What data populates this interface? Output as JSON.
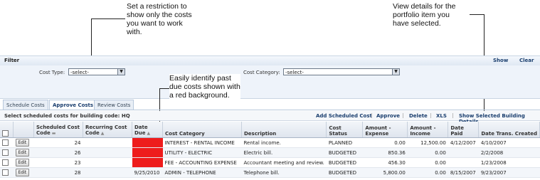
{
  "callouts": {
    "restriction": [
      "Set a restriction to",
      "show only the costs",
      "you want to work",
      "with."
    ],
    "details": [
      "View details for the",
      "portfolio item you",
      "have selected."
    ],
    "pastdue": [
      "Easily identify past",
      "due costs shown with",
      "a red background."
    ]
  },
  "filter": {
    "title": "Filter",
    "show": "Show",
    "clear": "Clear",
    "cost_type_label": "Cost Type:",
    "cost_type_value": "-select-",
    "cost_category_label": "Cost Category:",
    "cost_category_value": "-select-"
  },
  "tabs": [
    "Schedule Costs",
    "Approve Costs",
    "Review Costs"
  ],
  "actions": {
    "caption": "Select scheduled costs for building code: HQ",
    "add": "Add Scheduled Cost",
    "approve": "Approve",
    "delete": "Delete",
    "xls": "XLS",
    "show_details": "Show Selected Building Details"
  },
  "table": {
    "edit_label": "Edit",
    "headers": {
      "scheduled": "Scheduled Cost Code",
      "recurring": "Recurring Cost Code",
      "date_due": "Date Due",
      "category": "Cost Category",
      "description": "Description",
      "status": "Cost Status",
      "expense": "Amount - Expense",
      "income": "Amount - Income",
      "paid": "Date Paid",
      "created": "Date Trans. Created"
    },
    "rows": [
      {
        "scheduled": "24",
        "recurring": "",
        "date_due": "",
        "past_due": true,
        "category": "INTEREST - RENTAL INCOME",
        "description": "Rental income.",
        "status": "PLANNED",
        "expense": "0.00",
        "income": "12,500.00",
        "paid": "4/12/2007",
        "created": "4/10/2007"
      },
      {
        "scheduled": "26",
        "recurring": "",
        "date_due": "",
        "past_due": true,
        "category": "UTILITY - ELECTRIC",
        "description": "Electric bill.",
        "status": "BUDGETED",
        "expense": "850.36",
        "income": "0.00",
        "paid": "",
        "created": "2/2/2008"
      },
      {
        "scheduled": "23",
        "recurring": "",
        "date_due": "",
        "past_due": true,
        "category": "FEE - ACCOUNTING EXPENSE",
        "description": "Accountant meeting and review.",
        "status": "BUDGETED",
        "expense": "456.30",
        "income": "0.00",
        "paid": "",
        "created": "1/23/2008"
      },
      {
        "scheduled": "28",
        "recurring": "",
        "date_due": "9/25/2010",
        "past_due": false,
        "category": "ADMIN - TELEPHONE",
        "description": "Telephone bill.",
        "status": "BUDGETED",
        "expense": "5,800.00",
        "income": "0.00",
        "paid": "8/15/2007",
        "created": "9/23/2007"
      }
    ]
  },
  "colors": {
    "past_due": "#ee1c1c",
    "link": "#1a3e6e"
  }
}
